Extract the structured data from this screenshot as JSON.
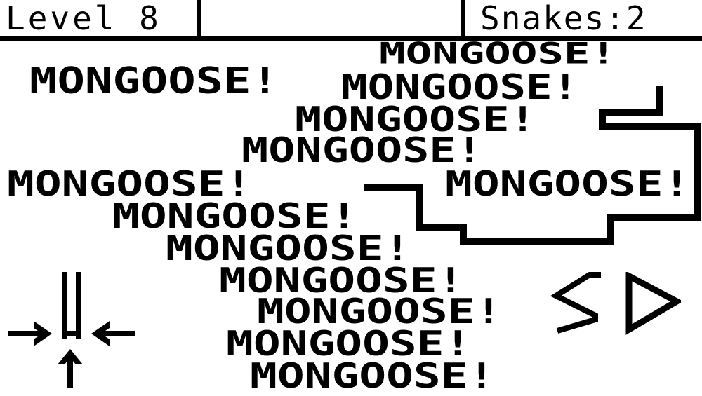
{
  "hud": {
    "level": "Level 8",
    "snakes": "Snakes:2"
  },
  "message": "MONGOOSE!",
  "controls": {
    "pause_icon": "pause-icon",
    "left_arrow_icon": "arrow-right-icon",
    "right_arrow_icon": "arrow-left-icon",
    "down_arrow_icon": "arrow-up-icon",
    "snake_logo_icon": "s-logo-icon",
    "play_icon": "play-triangle-icon"
  }
}
